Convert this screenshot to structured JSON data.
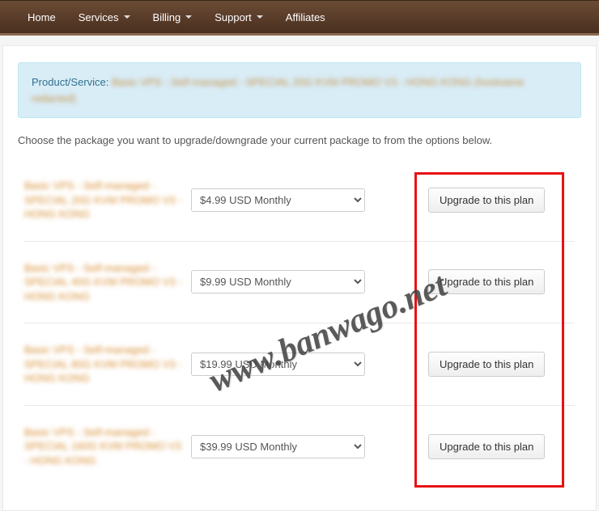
{
  "nav": {
    "home": "Home",
    "services": "Services",
    "billing": "Billing",
    "support": "Support",
    "affiliates": "Affiliates"
  },
  "info": {
    "label": "Product/Service:",
    "value": "Basic VPS - Self-managed - SPECIAL 20G KVM PROMO V3 - HONG KONG (hostname redacted)"
  },
  "instructions": "Choose the package you want to upgrade/downgrade your current package to from the options below.",
  "plans": [
    {
      "name": "Basic VPS - Self-managed - SPECIAL 20G KVM PROMO V3 - HONG KONG",
      "price_blurred": "$4.99",
      "price_period": " USD Monthly",
      "button": "Upgrade to this plan"
    },
    {
      "name": "Basic VPS - Self-managed - SPECIAL 40G KVM PROMO V3 - HONG KONG",
      "price_blurred": "$9.99",
      "price_period": " USD Monthly",
      "button": "Upgrade to this plan"
    },
    {
      "name": "Basic VPS - Self-managed - SPECIAL 80G KVM PROMO V3 - HONG KONG",
      "price_blurred": "$19.9",
      "price_period": "9 USD Monthly",
      "button": "Upgrade to this plan"
    },
    {
      "name": "Basic VPS - Self-managed - SPECIAL 160G KVM PROMO V3 - HONG KONG",
      "price_blurred": "$39.9",
      "price_period": "9 USD Monthly",
      "button": "Upgrade to this plan"
    }
  ],
  "watermark": "www.banwago.net"
}
